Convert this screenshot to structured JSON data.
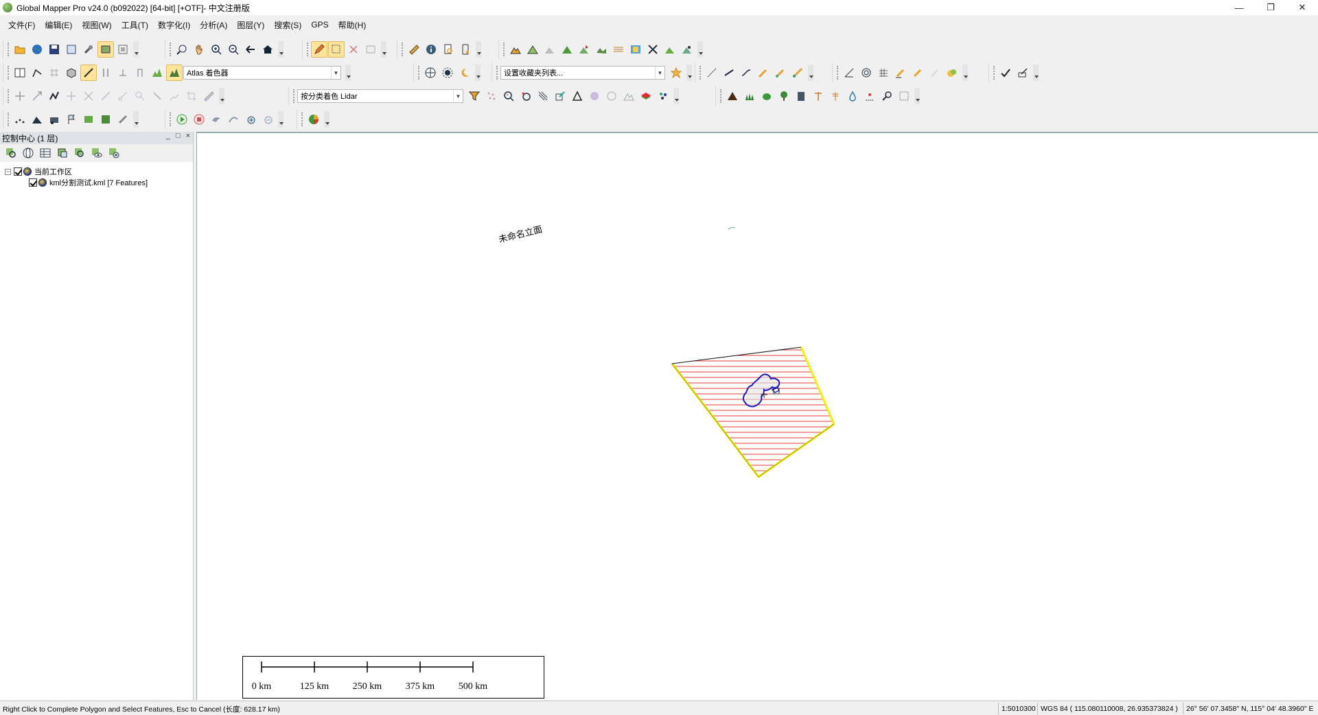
{
  "window": {
    "title": "Global Mapper Pro v24.0 (b092022) [64-bit] [+OTF]- 中文注册版",
    "min_glyph": "—",
    "restore_glyph": "❐",
    "close_glyph": "✕"
  },
  "menu": [
    {
      "label": "文件(F)"
    },
    {
      "label": "编辑(E)"
    },
    {
      "label": "视图(W)"
    },
    {
      "label": "工具(T)"
    },
    {
      "label": "数字化(I)"
    },
    {
      "label": "分析(A)"
    },
    {
      "label": "图层(Y)"
    },
    {
      "label": "搜索(S)"
    },
    {
      "label": "GPS"
    },
    {
      "label": "帮助(H)"
    }
  ],
  "toolbar": {
    "shader_select": "Atlas 着色器",
    "favorites_select": "设置收藏夹列表...",
    "lidar_select": "按分类着色 Lidar"
  },
  "control_center": {
    "title": "控制中心 (1 层)",
    "minimize_glyph": "_",
    "float_glyph": "□",
    "close_glyph": "×",
    "tree": {
      "workspace_label": "当前工作区",
      "expander_glyph": "−",
      "layers": [
        {
          "label": "kml分割测试.kml [7 Features]"
        }
      ]
    }
  },
  "map": {
    "feature_label": "未命名立面",
    "colors": {
      "polygon_outline": "#f5f000",
      "hatch": "#e23b3b",
      "inner_outline": "#1a1ac8",
      "selection_edge": "#111111"
    },
    "scale_bar": {
      "labels": [
        "0 km",
        "125 km",
        "250 km",
        "375 km",
        "500 km"
      ]
    }
  },
  "status": {
    "message": "Right Click to Complete Polygon and Select Features, Esc to Cancel (长度: 628.17 km)",
    "scale": "1:5010300",
    "datum": "WGS 84 ( 115.080110008, 26.935373824 )",
    "coords": "26° 56' 07.3458\" N, 115° 04' 48.3960\" E"
  }
}
